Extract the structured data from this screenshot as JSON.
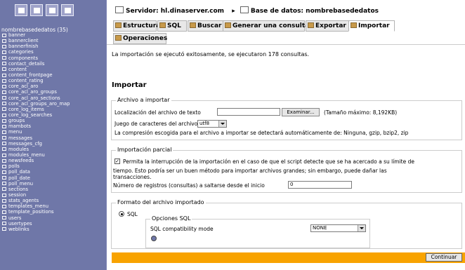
{
  "sidebar": {
    "nav_icons": [
      "home-icon",
      "database-icon",
      "query-icon",
      "docs-icon"
    ],
    "db_title": "nombrebasededatos (35)",
    "tables": [
      "banner",
      "bannerclient",
      "bannerfinish",
      "categories",
      "components",
      "contact_details",
      "content",
      "content_frontpage",
      "content_rating",
      "core_acl_aro",
      "core_acl_aro_groups",
      "core_acl_aro_sections",
      "core_acl_groups_aro_map",
      "core_log_items",
      "core_log_searches",
      "groups",
      "mambots",
      "menu",
      "messages",
      "messages_cfg",
      "modules",
      "modules_menu",
      "newsfeeds",
      "polls",
      "poll_data",
      "poll_date",
      "poll_menu",
      "sections",
      "session",
      "stats_agents",
      "templates_menu",
      "template_positions",
      "users",
      "usertypes",
      "weblinks"
    ]
  },
  "header": {
    "server_label": "Servidor: hl.dinaserver.com",
    "db_label": "Base de datos: nombrebasededatos"
  },
  "tabs": [
    {
      "label": "Estructura",
      "active": false
    },
    {
      "label": "SQL",
      "active": false
    },
    {
      "label": "Buscar",
      "active": false
    },
    {
      "label": "Generar una consulta",
      "active": false
    },
    {
      "label": "Exportar",
      "active": false
    },
    {
      "label": "Importar",
      "active": true
    },
    {
      "label": "Operaciones",
      "active": false
    }
  ],
  "message": "La importación se ejecutó exitosamente, se ejecutaron 178 consultas.",
  "import_section": {
    "title": "Importar",
    "file_fieldset": {
      "legend": "Archivo a importar",
      "file_label": "Localización del archivo de texto",
      "browse_label": "Examinar...",
      "max_size": "(Tamaño máximo: 8,192KB)",
      "charset_label": "Juego de caracteres del archivo:",
      "charset_value": "utf8",
      "compression_note": "La compresión escogida para el archivo a importar se detectará automáticamente de: Ninguna, gzip, bzip2, zip"
    },
    "partial_fieldset": {
      "legend": "Importación parcial",
      "allow_interrupt_label": "Permita la interrupción de la importación en el caso de que el script detecte que se ha acercado a su límite de",
      "allow_interrupt_cont1": "tiempo. Esto podría ser un buen método para importar archivos grandes; sin embargo, puede dañar las",
      "allow_interrupt_cont2": "transacciones.",
      "skip_label": "Número de registros (consultas) a saltarse desde el inicio",
      "skip_value": "0"
    },
    "format_fieldset": {
      "legend": "Formato del archivo importado",
      "format_option": "SQL",
      "options_legend": "Opciones SQL",
      "compat_label": "SQL compatibility mode",
      "compat_value": "NONE"
    },
    "submit_label": "Continuar"
  },
  "colors": {
    "sidebar_bg": "#6f77a8",
    "footer_bar": "#f8a300"
  }
}
